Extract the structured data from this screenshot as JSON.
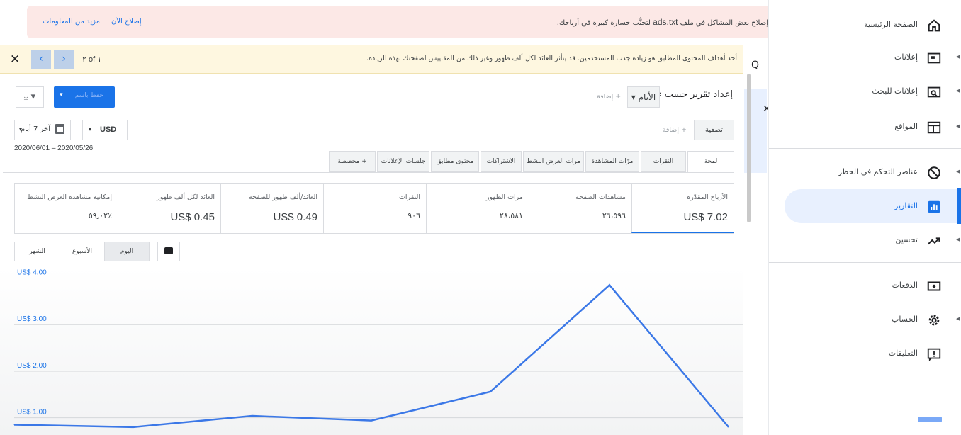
{
  "alert": {
    "message_pre": "إصلاح بعض المشاكل في ملف ",
    "message_file": "ads.txt",
    "message_post": " لتجنُّب خسارة كبيرة في أرباحك.",
    "fix_now": "إصلاح الآن",
    "learn_more": "مزيد من المعلومات"
  },
  "tips_bar": {
    "message": "أحد أهداف المحتوى المطابق هو زيادة جذب المستخدمين. قد يتأثر العائد لكل ألف ظهور وغير ذلك من المقاييس لصفحتك بهذه الزيادة.",
    "counter": "٢ of ١",
    "close": "✕",
    "prev": "‹",
    "next": "›"
  },
  "toolbar": {
    "report_by": "إعداد تقرير حسب",
    "report_by_sep": "›",
    "dimension": "الأيام ▾",
    "add_dimension": "+ إضافة",
    "save_label": "حفظ باسم",
    "save_caret": "▾",
    "download_icon": "⤓ ▾",
    "filter_label": "تصفية",
    "filter_add": "+ إضافة",
    "currency": "USD",
    "currency_caret": "▾",
    "date_range": "آخر 7 أيام",
    "date_caret": "▾",
    "date_range_text": "2020/06/01 – 2020/05/26"
  },
  "tabs": [
    {
      "label": "لمحة",
      "active": true
    },
    {
      "label": "النقرات",
      "active": false
    },
    {
      "label": "مرّات المشاهدة",
      "active": false
    },
    {
      "label": "مرات العرض النشط",
      "active": false
    },
    {
      "label": "الاشتراكات",
      "active": false
    },
    {
      "label": "محتوى مطابق",
      "active": false
    },
    {
      "label": "جلسات الإعلانات",
      "active": false
    },
    {
      "label": "+ مخصصة",
      "active": false
    }
  ],
  "metrics": [
    {
      "label": "الأرباح المقدّرة",
      "value": "US$ 7.02"
    },
    {
      "label": "مشاهدات الصفحة",
      "value": "٢٦،٥٩٦"
    },
    {
      "label": "مرات الظهور",
      "value": "٢٨،٥٨١"
    },
    {
      "label": "النقرات",
      "value": "٩٠٦"
    },
    {
      "label": "العائد/ألف ظهور للصفحة",
      "value": "US$ 0.49"
    },
    {
      "label": "العائد لكل ألف ظهور",
      "value": "US$ 0.45"
    },
    {
      "label": "إمكانية مشاهدة العرض النشط",
      "value": "٥٩٫٠٢٪"
    }
  ],
  "period": {
    "day": "اليوم",
    "week": "الأسبوع",
    "month": "الشهر"
  },
  "chart_data": {
    "type": "line",
    "y_tick_labels": [
      "US$ 4.00",
      "US$ 3.00",
      "US$ 2.00",
      "US$ 1.00"
    ],
    "y_ticks": [
      4,
      3,
      2,
      1
    ],
    "ylim": [
      0.63,
      4.22
    ],
    "grid": true,
    "series": [
      {
        "color": "#3b78e7",
        "values": [
          0.85,
          0.8,
          1.04,
          0.94,
          1.56,
          3.85,
          0.8
        ]
      }
    ]
  },
  "sidebar": {
    "items": [
      {
        "label": "الصفحة الرئيسية",
        "icon": "home-icon",
        "arrow": false
      },
      {
        "label": "إعلانات",
        "icon": "ads-icon",
        "arrow": true
      },
      {
        "label": "إعلانات للبحث",
        "icon": "search-ads-icon",
        "arrow": true
      },
      {
        "label": "المواقع",
        "icon": "sites-icon",
        "arrow": true
      },
      {
        "label": "عناصر التحكم في الحظر",
        "icon": "block-icon",
        "arrow": true
      },
      {
        "label": "التقارير",
        "icon": "reports-icon",
        "arrow": false
      },
      {
        "label": "تحسين",
        "icon": "optimize-icon",
        "arrow": true
      },
      {
        "label": "الدفعات",
        "icon": "payments-icon",
        "arrow": false
      },
      {
        "label": "الحساب",
        "icon": "gear-icon",
        "arrow": true
      },
      {
        "label": "التعليقات",
        "icon": "feedback-icon",
        "arrow": false
      }
    ]
  },
  "colors": {
    "accent": "#1a73e8",
    "alert_bg": "#fce8e6",
    "tips_bg": "#fef7e0",
    "line": "#3b78e7"
  }
}
